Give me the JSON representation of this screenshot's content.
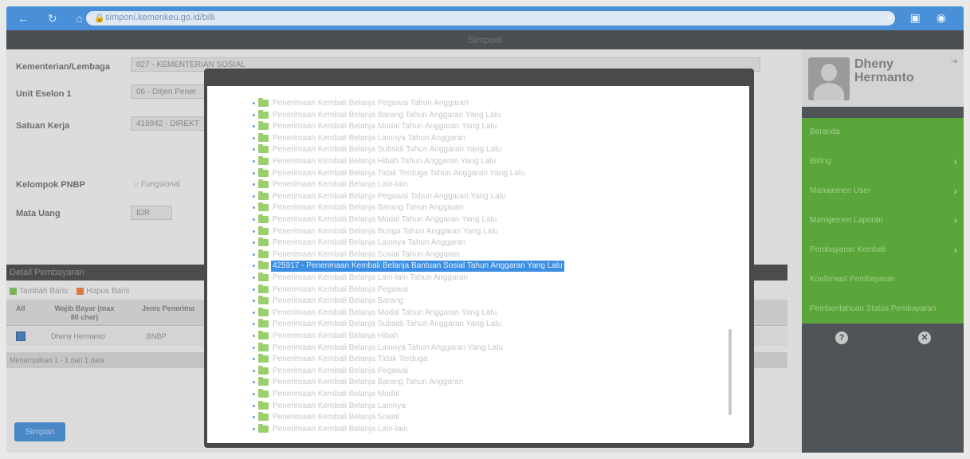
{
  "browser": {
    "url": "simponi.kemenkeu.go.id/billi",
    "nav_icons": "← ↻ ⌂",
    "ext_icons": "✦ ▣ ◉"
  },
  "app": {
    "title": "Simponi"
  },
  "form": {
    "kementerian_label": "Kementerian/Lembaga",
    "kementerian_value": "027 - KEMENTERIAN SOSIAL",
    "unit_label": "Unit Eselon 1",
    "unit_value": "06 - Ditjen Pener",
    "satuan_label": "Satuan Kerja",
    "satuan_value": "418942 - DIREKT",
    "kelompok_label": "Kelompok PNBP",
    "kelompok_option": "Fungsional",
    "mata_uang_label": "Mata Uang",
    "mata_uang_value": "IDR"
  },
  "detail": {
    "header": "Detail Pembayaran",
    "add_row": "Tambah Baris",
    "delete_row": "Hapus Baris",
    "col_all": "All",
    "col_wajib_bayar": "Wajib Bayar (max 80 char)",
    "col_jenis": "Jenis Penerima",
    "row_name": "Dheny Hermanto",
    "row_jenis": "BNBP",
    "footer": "Menampilkan 1 - 1 dari 1 data",
    "save": "Simpan"
  },
  "sidebar": {
    "user_name": "Dheny Hermanto",
    "menu_items": [
      {
        "label": "Beranda",
        "chevron": ""
      },
      {
        "label": "Billing",
        "chevron": "›"
      },
      {
        "label": "Manajemen User",
        "chevron": "›"
      },
      {
        "label": "Manajemen Laporan",
        "chevron": "›"
      },
      {
        "label": "Pembayaran Kembali",
        "chevron": "›"
      },
      {
        "label": "Konfirmasi Pembayaran",
        "chevron": ""
      },
      {
        "label": "Pemberitahuan Status Pembayaran",
        "chevron": ""
      }
    ],
    "help_icon_glyph": "?",
    "close_icon_glyph": "✕"
  },
  "modal": {
    "tree_items": [
      "Penerimaan Kembali Belanja Pegawai Tahun Anggaran",
      "Penerimaan Kembali Belanja Barang Tahun Anggaran Yang Lalu",
      "Penerimaan Kembali Belanja Modal Tahun Anggaran Yang Lalu",
      "Penerimaan Kembali Belanja Lainnya Tahun Anggaran",
      "Penerimaan Kembali Belanja Subsidi Tahun Anggaran Yang Lalu",
      "Penerimaan Kembali Belanja Hibah Tahun Anggaran Yang Lalu",
      "Penerimaan Kembali Belanja Tidak Terduga Tahun Anggaran Yang Lalu",
      "Penerimaan Kembali Belanja Lain-lain",
      "Penerimaan Kembali Belanja Pegawai Tahun Anggaran Yang Lalu",
      "Penerimaan Kembali Belanja Barang Tahun Anggaran",
      "Penerimaan Kembali Belanja Modal Tahun Anggaran Yang Lalu",
      "Penerimaan Kembali Belanja Bunga Tahun Anggaran Yang Lalu",
      "Penerimaan Kembali Belanja Lainnya Tahun Anggaran",
      "Penerimaan Kembali Belanja Sosial Tahun Anggaran",
      "425917 - Penerimaan Kembali Belanja Bantuan Sosial Tahun Anggaran Yang Lalu",
      "Penerimaan Kembali Belanja Lain-lain Tahun Anggaran",
      "Penerimaan Kembali Belanja Pegawai",
      "Penerimaan Kembali Belanja Barang",
      "Penerimaan Kembali Belanja Modal Tahun Anggaran Yang Lalu",
      "Penerimaan Kembali Belanja Subsidi Tahun Anggaran Yang Lalu",
      "Penerimaan Kembali Belanja Hibah",
      "Penerimaan Kembali Belanja Lainnya Tahun Anggaran Yang Lalu",
      "Penerimaan Kembali Belanja Tidak Terduga",
      "Penerimaan Kembali Belanja Pegawai",
      "Penerimaan Kembali Belanja Barang Tahun Anggaran",
      "Penerimaan Kembali Belanja Modal",
      "Penerimaan Kembali Belanja Lainnya",
      "Penerimaan Kembali Belanja Sosial",
      "Penerimaan Kembali Belanja Lain-lain"
    ],
    "selected_index": 14
  }
}
